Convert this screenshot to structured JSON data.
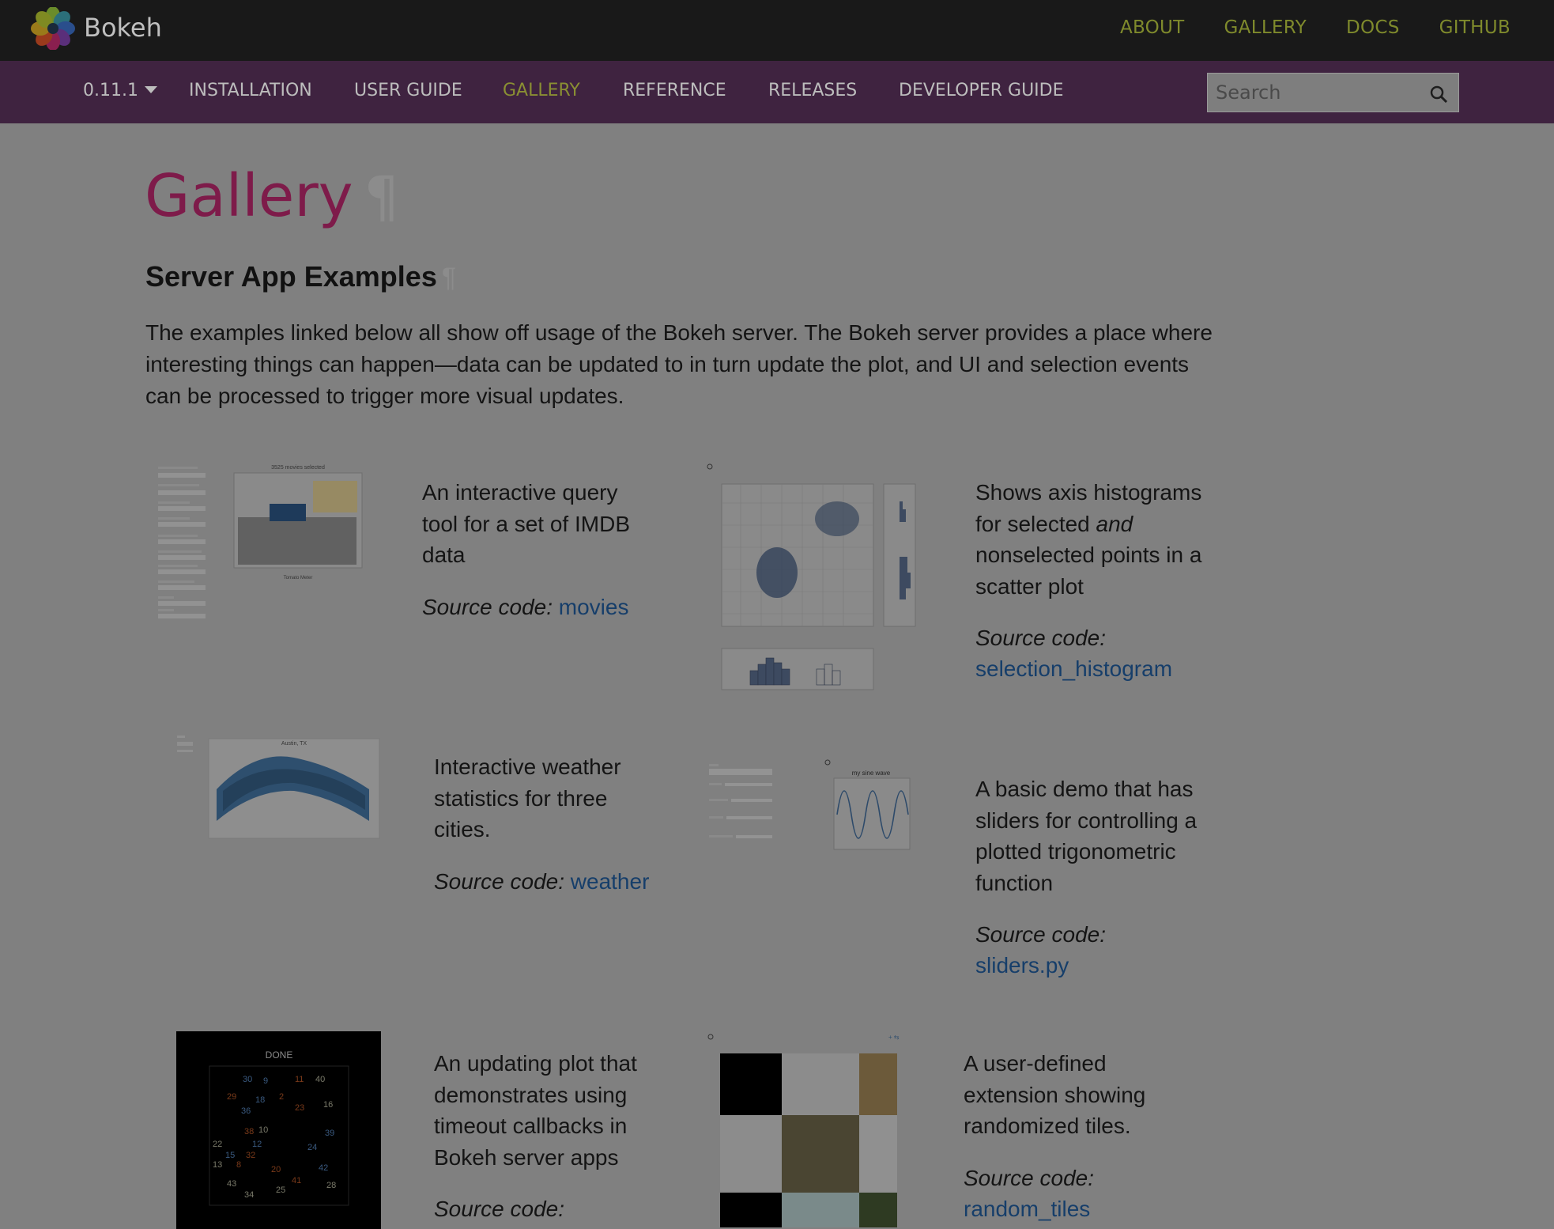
{
  "brand": "Bokeh",
  "topnav": [
    "ABOUT",
    "GALLERY",
    "DOCS",
    "GITHUB"
  ],
  "subnav": {
    "version": "0.11.1",
    "items": [
      "INSTALLATION",
      "USER GUIDE",
      "GALLERY",
      "REFERENCE",
      "RELEASES",
      "DEVELOPER GUIDE"
    ],
    "active": "GALLERY"
  },
  "search": {
    "placeholder": "Search"
  },
  "page": {
    "title": "Gallery",
    "pilcrow": "¶",
    "section_title": "Server App Examples",
    "intro": "The examples linked below all show off usage of the Bokeh server. The Bokeh server provides a place where interesting things can happen—data can be updated to in turn update the plot, and UI and selection events can be processed to trigger more visual updates."
  },
  "examples": [
    {
      "description": "An interactive query tool for a set of IMDB data",
      "source_label": "Source code:",
      "link": "movies",
      "thumb_title": "3525 movies selected"
    },
    {
      "description_parts": [
        "Shows axis histograms for selected ",
        "and",
        " nonselected points in a scatter plot"
      ],
      "source_label": "Source code:",
      "link": "selection_histogram"
    },
    {
      "description": "Interactive weather statistics for three cities.",
      "source_label": "Source code:",
      "link": "weather",
      "thumb_title": "Austin, TX"
    },
    {
      "description": "A basic demo that has sliders for controlling a plotted trigonometric function",
      "source_label": "Source code:",
      "link": "sliders.py",
      "thumb_title": "my sine wave"
    },
    {
      "description": "An updating plot that demonstrates using timeout callbacks in Bokeh server apps",
      "source_label": "Source code:",
      "thumb_title": "DONE"
    },
    {
      "description": "A user-defined extension showing randomized tiles.",
      "source_label": "Source code:",
      "link": "random_tiles"
    }
  ],
  "colors": {
    "topbar": "#191919",
    "subnav": "#3f2340",
    "title": "#7e1b4a",
    "link": "#163e6a",
    "nav_active": "#8a8f33"
  }
}
